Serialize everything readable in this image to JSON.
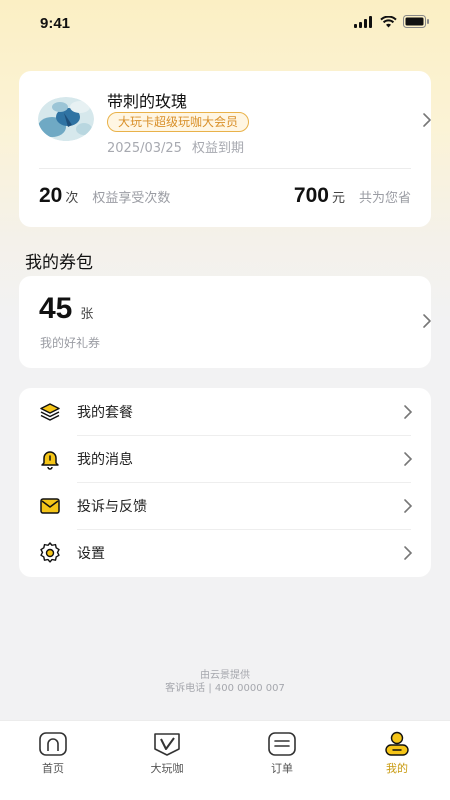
{
  "status_bar": {
    "time": "9:41"
  },
  "profile": {
    "username": "带刺的玫瑰",
    "member_badge": "大玩卡超级玩咖大会员",
    "expire_date": "2025/03/25",
    "expire_label": "权益到期",
    "usage_count": "20",
    "usage_unit": "次",
    "usage_label": "权益享受次数",
    "saved_amount": "700",
    "saved_unit": "元",
    "saved_label": "共为您省"
  },
  "coupons": {
    "section_title": "我的券包",
    "count": "45",
    "unit": "张",
    "label": "我的好礼券"
  },
  "menu": [
    {
      "label": "我的套餐",
      "icon": "layers-icon"
    },
    {
      "label": "我的消息",
      "icon": "bell-icon"
    },
    {
      "label": "投诉与反馈",
      "icon": "mail-icon"
    },
    {
      "label": "设置",
      "icon": "gear-icon"
    }
  ],
  "footer": {
    "provider": "由云景提供",
    "phone": "客诉电话 | 400 0000 007"
  },
  "tabbar": [
    {
      "label": "首页",
      "icon": "home-icon",
      "active": false
    },
    {
      "label": "大玩咖",
      "icon": "card-icon",
      "active": false
    },
    {
      "label": "订单",
      "icon": "order-icon",
      "active": false
    },
    {
      "label": "我的",
      "icon": "user-icon",
      "active": true
    }
  ],
  "colors": {
    "accent": "#f5c518",
    "badge_border": "#e9b24a",
    "badge_text": "#d9902a"
  }
}
